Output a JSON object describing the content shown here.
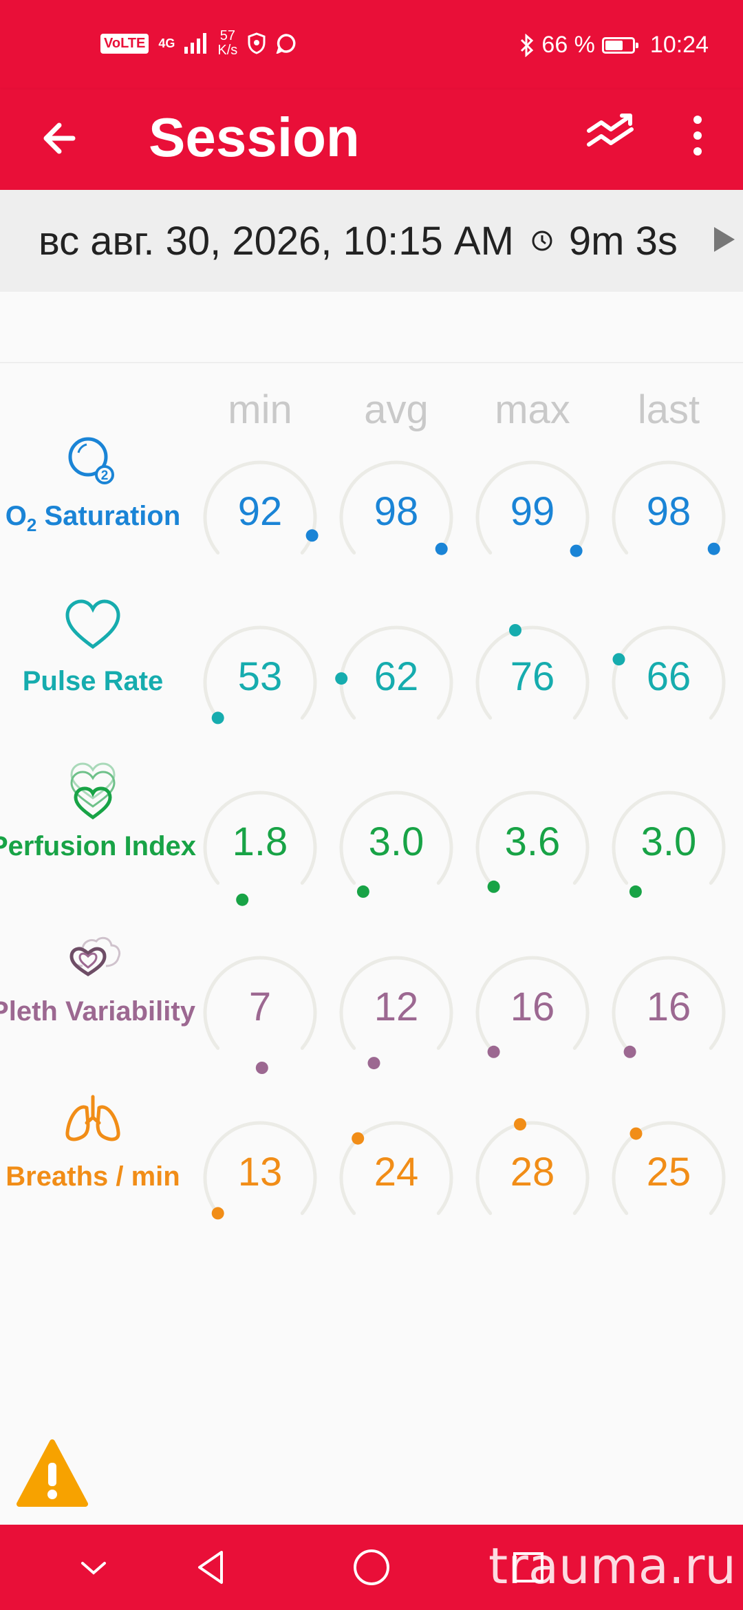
{
  "status_bar": {
    "volte": "VoLTE",
    "network": "4G",
    "speed_value": "57",
    "speed_unit": "K/s",
    "battery_percent_label": "66 %",
    "battery_level": 0.66,
    "time": "10:24"
  },
  "app_bar": {
    "title": "Session",
    "back_icon": "arrow-left-icon",
    "trend_icon": "trend-chart-icon",
    "menu_icon": "more-vertical-icon"
  },
  "session": {
    "date": "вс авг. 30, 2026, 10:15 AM",
    "duration": "9m 3s"
  },
  "columns": [
    "min",
    "avg",
    "max",
    "last"
  ],
  "metrics": [
    {
      "key": "spo2",
      "label_main": "O",
      "label_sub": "2",
      "label_rest": " Saturation",
      "icon": "o2-bubble-icon",
      "color": "#1a84d6",
      "values": [
        "92",
        "98",
        "99",
        "98"
      ],
      "fractions": [
        0.92,
        0.98,
        0.99,
        0.98
      ]
    },
    {
      "key": "pulse",
      "label": "Pulse Rate",
      "icon": "heart-icon",
      "color": "#16acae",
      "values": [
        "53",
        "62",
        "76",
        "66"
      ],
      "fractions": [
        0.0,
        0.17,
        0.43,
        0.25
      ]
    },
    {
      "key": "pi",
      "label": "Perfusion Index",
      "icon": "stacked-hearts-icon",
      "color": "#18a346",
      "values": [
        "1.8",
        "3.0",
        "3.6",
        "3.0"
      ],
      "fractions": [
        -0.12,
        -0.05,
        -0.02,
        -0.05
      ]
    },
    {
      "key": "pvi",
      "label": "Pleth Variability",
      "icon": "heart-cloud-icon",
      "color": "#9c6891",
      "values": [
        "7",
        "12",
        "16",
        "16"
      ],
      "fractions": [
        -0.2,
        -0.1,
        -0.02,
        -0.02
      ]
    },
    {
      "key": "rr",
      "label": "Breaths / min",
      "icon": "lungs-icon",
      "color": "#f18d17",
      "values": [
        "13",
        "24",
        "28",
        "25"
      ],
      "fractions": [
        0.0,
        0.33,
        0.45,
        0.36
      ]
    }
  ],
  "warning_icon": "warning-triangle-icon",
  "watermark": "trauma.ru"
}
